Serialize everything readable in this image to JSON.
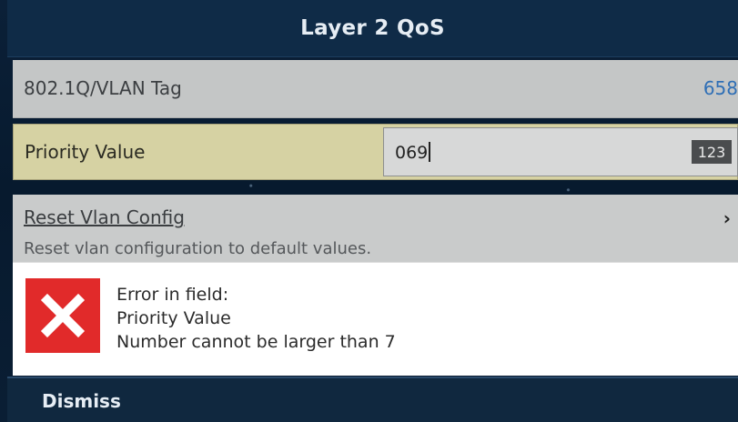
{
  "title": "Layer 2 QoS",
  "vlan_tag": {
    "label": "802.1Q/VLAN Tag",
    "value": "658"
  },
  "priority": {
    "label": "Priority Value",
    "input_value": "069",
    "keyboard_mode": "123"
  },
  "reset": {
    "label": "Reset Vlan Config",
    "description": "Reset vlan configuration to default values.",
    "chevron": "›"
  },
  "error": {
    "icon": "error-x-icon",
    "line1": "Error in field:",
    "line2": "Priority Value",
    "line3": "Number cannot be larger than 7"
  },
  "dismiss_label": "Dismiss",
  "colors": {
    "title_bar": "#0f2b47",
    "highlight_row": "#d6d2a3",
    "link_value": "#2f6fb6",
    "error_red": "#e12a2a"
  }
}
